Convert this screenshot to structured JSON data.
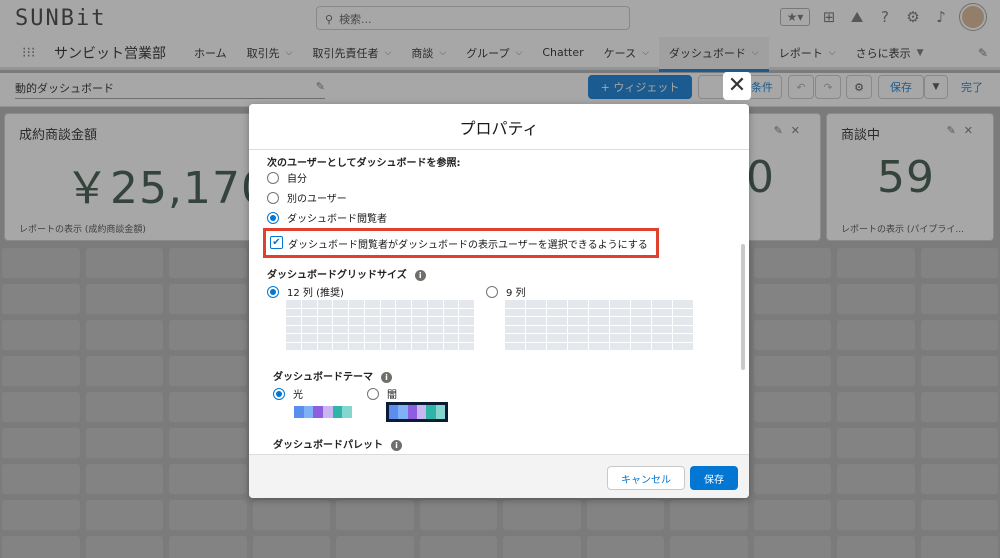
{
  "app": {
    "logo_text": "SUNBit",
    "search_placeholder": "検索...",
    "app_name": "サンビット営業部",
    "nav_items": [
      {
        "label": "ホーム",
        "chevron": false
      },
      {
        "label": "取引先",
        "chevron": true
      },
      {
        "label": "取引先責任者",
        "chevron": true
      },
      {
        "label": "商談",
        "chevron": true
      },
      {
        "label": "グループ",
        "chevron": true
      },
      {
        "label": "Chatter",
        "chevron": false
      },
      {
        "label": "ケース",
        "chevron": true
      },
      {
        "label": "ダッシュボード",
        "chevron": true
      },
      {
        "label": "レポート",
        "chevron": true
      },
      {
        "label": "さらに表示",
        "chevron": true
      }
    ]
  },
  "dashboard": {
    "title": "動的ダッシュボード",
    "buttons": {
      "add_widget": "+ ウィジェット",
      "filter": "条件",
      "save": "保存",
      "done": "完了"
    },
    "widgets": [
      {
        "title": "成約商談金額",
        "value": "￥25,170",
        "footer": "レポートの表示 (成約商談金額)"
      },
      {
        "title": "",
        "value": "0",
        "footer": ""
      },
      {
        "title": "商談中",
        "value": "59",
        "footer": "レポートの表示 (パイプライ..."
      }
    ]
  },
  "modal": {
    "title": "プロパティ",
    "view_as_label": "次のユーザーとしてダッシュボードを参照:",
    "view_as_options": [
      {
        "label": "自分",
        "selected": false
      },
      {
        "label": "別のユーザー",
        "selected": false
      },
      {
        "label": "ダッシュボード閲覧者",
        "selected": true
      }
    ],
    "checkbox_label": "ダッシュボード閲覧者がダッシュボードの表示ユーザーを選択できるようにする",
    "checkbox_checked": true,
    "grid_size_label": "ダッシュボードグリッドサイズ",
    "grid_options": [
      {
        "label": "12 列 (推奨)",
        "selected": true
      },
      {
        "label": "9 列",
        "selected": false
      }
    ],
    "theme_label": "ダッシュボードテーマ",
    "theme_options": [
      {
        "label": "光",
        "selected": true
      },
      {
        "label": "闇",
        "selected": false
      }
    ],
    "palette_label": "ダッシュボードパレット",
    "cancel_label": "キャンセル",
    "save_label": "保存"
  },
  "colors": {
    "brand": "#0176d3",
    "highlight": "#e0412e",
    "swatch": [
      "#5b8def",
      "#7fb2f5",
      "#8e5ee0",
      "#c9b6f0",
      "#2fb5a8",
      "#84d6cf"
    ]
  }
}
